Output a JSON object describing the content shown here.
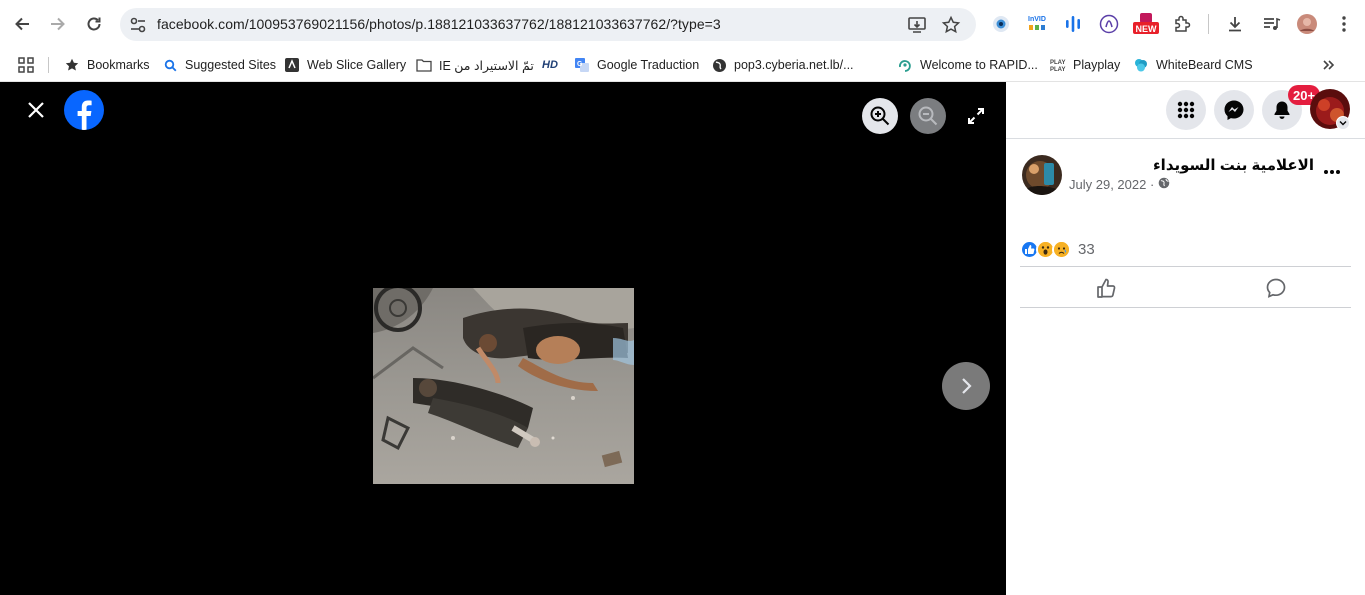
{
  "browser": {
    "url": "facebook.com/100953769021156/photos/p.188121033637762/188121033637762/?type=3",
    "icons": [
      "back-icon",
      "forward-icon",
      "reload-icon",
      "site-settings-icon",
      "install-app-icon",
      "bookmark-star-icon",
      "extensions-icon",
      "download-icon",
      "media-controls-icon",
      "kebab-menu-icon"
    ],
    "extensions": {
      "invid_label": "InVID",
      "new_badge": "NEW"
    }
  },
  "bookmarks": [
    {
      "label": "Bookmarks",
      "icon": "star-icon"
    },
    {
      "label": "Suggested Sites",
      "icon": "search-icon"
    },
    {
      "label": "Web Slice Gallery",
      "icon": "web-slice-icon"
    },
    {
      "label": "تمّ الاستيراد من IE",
      "icon": "folder-icon"
    },
    {
      "label": "",
      "icon": "hd-icon",
      "badge": "HD"
    },
    {
      "label": "Google Traduction",
      "icon": "translate-icon"
    },
    {
      "label": "pop3.cyberia.net.lb/...",
      "icon": "globe-icon"
    },
    {
      "label": "Welcome to RAPID...",
      "icon": "rapid-icon"
    },
    {
      "label": "Playplay",
      "icon": "playplay-icon"
    },
    {
      "label": "WhiteBeard CMS",
      "icon": "whitebeard-icon"
    }
  ],
  "viewer": {
    "icons": [
      "close-icon",
      "facebook-logo",
      "zoom-in-icon",
      "zoom-out-icon",
      "fullscreen-icon",
      "next-photo-icon"
    ],
    "photo": "street-scene-photo"
  },
  "panel": {
    "notification_count": "20+",
    "author_name": "الاعلامية بنت السويداء",
    "post_date": "July 29, 2022 ·",
    "privacy": "globe-icon",
    "reaction_count": "33",
    "reactions": [
      "like-icon",
      "wow-icon",
      "sad-icon"
    ],
    "actions": [
      "like-button",
      "comment-button"
    ]
  },
  "colors": {
    "facebook_blue": "#0866ff",
    "badge_red": "#e41e3f",
    "viewer_bg": "#000000"
  }
}
